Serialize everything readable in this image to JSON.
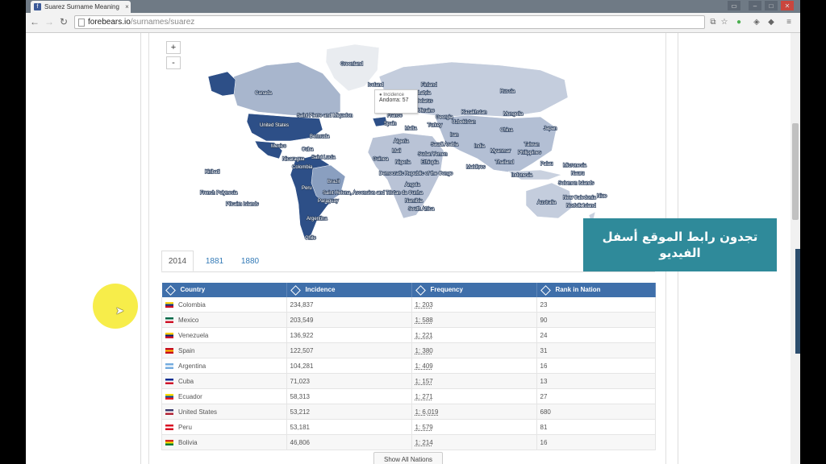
{
  "browser": {
    "tab_title": "Suarez Surname Meaning",
    "tab_close": "×",
    "url_host": "forebears.io",
    "url_path": "/surnames/suarez"
  },
  "map": {
    "zoom_in": "+",
    "zoom_out": "-",
    "tooltip_label": "Incidence",
    "tooltip_value": "Andorra: 57",
    "labels": {
      "greenland": "Greenland",
      "iceland": "Iceland",
      "finland": "Finland",
      "russia": "Russia",
      "canada": "Canada",
      "united_states": "United States",
      "mexico": "Mexico",
      "cuba": "Cuba",
      "bermuda": "Bermuda",
      "saint_pierre": "Saint Pierre and Miquelon",
      "saint_lucia": "Saint Lucia",
      "nicaragua": "Nicaragua",
      "colombia": "Colombia",
      "brazil": "Brazil",
      "peru": "Peru",
      "paraguay": "Paraguay",
      "argentina": "Argentina",
      "chile": "Chile",
      "kiribati": "Kiribati",
      "french_polynesia": "French Polynesia",
      "pitcairn": "Pitcairn Islands",
      "saint_helena": "Saint Helena, Ascension and Tristan da Cunha",
      "spain": "Spain",
      "malta": "Malta",
      "turkey": "Turkey",
      "kazakhstan": "Kazakhstan",
      "mongolia": "Mongolia",
      "ukraine": "Ukraine",
      "uzbekistan": "Uzbekistan",
      "china": "China",
      "japan": "Japan",
      "iran": "Iran",
      "india": "India",
      "myanmar": "Myanmar",
      "taiwan": "Taiwan",
      "philippines": "Philippines",
      "thailand": "Thailand",
      "palau": "Palau",
      "micronesia": "Micronesia",
      "nauru": "Nauru",
      "solomon": "Solomon Islands",
      "indonesia": "Indonesia",
      "australia": "Australia",
      "new_caledonia": "New Caledonia",
      "norfolk": "Norfolk Island",
      "niue": "Niue",
      "algeria": "Algeria",
      "mali": "Mali",
      "guinea": "Guinea",
      "nigeria": "Nigeria",
      "sudan": "Sudan",
      "yemen": "Yemen",
      "ethiopia": "Ethiopia",
      "saudi": "Saudi Arabia",
      "maldives": "Maldives",
      "drc": "Democratic Republic of the Congo",
      "angola": "Angola",
      "namibia": "Namibia",
      "south_africa": "South Africa",
      "latvia": "Latvia",
      "belarus": "Belarus",
      "france": "France",
      "georgia": "Georgia"
    }
  },
  "overlay_banner": {
    "line1": "تجدون رابط الموقع أسفل",
    "line2": "الفيديو"
  },
  "year_tabs": [
    "2014",
    "1881",
    "1880"
  ],
  "table": {
    "headers": [
      "Country",
      "Incidence",
      "Frequency",
      "Rank in Nation"
    ],
    "rows": [
      {
        "country": "Colombia",
        "incidence": "234,837",
        "frequency": "1: 203",
        "rank": "23",
        "flag_top": "#fcd116",
        "flag_mid": "#003893",
        "flag_bot": "#ce1126"
      },
      {
        "country": "Mexico",
        "incidence": "203,549",
        "frequency": "1: 588",
        "rank": "90",
        "flag_top": "#006847",
        "flag_mid": "#ffffff",
        "flag_bot": "#ce1126"
      },
      {
        "country": "Venezuela",
        "incidence": "136,922",
        "frequency": "1: 221",
        "rank": "24",
        "flag_top": "#ffcc00",
        "flag_mid": "#00247d",
        "flag_bot": "#cf142b"
      },
      {
        "country": "Spain",
        "incidence": "122,507",
        "frequency": "1: 380",
        "rank": "31",
        "flag_top": "#c60b1e",
        "flag_mid": "#ffc400",
        "flag_bot": "#c60b1e"
      },
      {
        "country": "Argentina",
        "incidence": "104,281",
        "frequency": "1: 409",
        "rank": "16",
        "flag_top": "#74acdf",
        "flag_mid": "#ffffff",
        "flag_bot": "#74acdf"
      },
      {
        "country": "Cuba",
        "incidence": "71,023",
        "frequency": "1: 157",
        "rank": "13",
        "flag_top": "#002a8f",
        "flag_mid": "#ffffff",
        "flag_bot": "#cf142b"
      },
      {
        "country": "Ecuador",
        "incidence": "58,313",
        "frequency": "1: 271",
        "rank": "27",
        "flag_top": "#ffdd00",
        "flag_mid": "#034ea2",
        "flag_bot": "#ed1c24"
      },
      {
        "country": "United States",
        "incidence": "53,212",
        "frequency": "1: 6,019",
        "rank": "680",
        "flag_top": "#3c3b6e",
        "flag_mid": "#ffffff",
        "flag_bot": "#b22234"
      },
      {
        "country": "Peru",
        "incidence": "53,181",
        "frequency": "1: 579",
        "rank": "81",
        "flag_top": "#d91023",
        "flag_mid": "#ffffff",
        "flag_bot": "#d91023"
      },
      {
        "country": "Bolivia",
        "incidence": "46,806",
        "frequency": "1: 214",
        "rank": "16",
        "flag_top": "#d52b1e",
        "flag_mid": "#f9e300",
        "flag_bot": "#007934"
      }
    ]
  },
  "show_all_label": "Show All Nations",
  "colors": {
    "map_dark": "#2d4f87",
    "map_mid": "#8a9fc0",
    "map_light": "#c4cddd",
    "table_header": "#3f6faa",
    "banner": "#2f8a9a"
  }
}
